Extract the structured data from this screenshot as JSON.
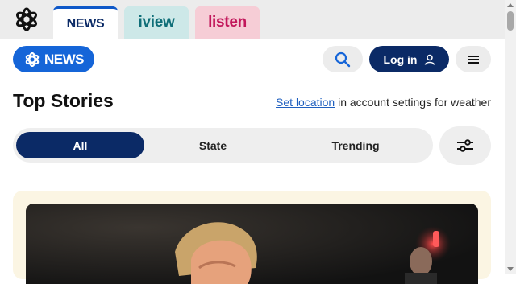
{
  "network": {
    "tabs": [
      {
        "label": "NEWS",
        "active": true,
        "color": "#0b2a66"
      },
      {
        "label": "iview",
        "active": false,
        "color": "#0f6e78"
      },
      {
        "label": "listen",
        "active": false,
        "color": "#c2175b"
      }
    ]
  },
  "header": {
    "logo_text": "NEWS",
    "login_label": "Log in",
    "brand_color": "#1565d8",
    "dark_color": "#0b2a66"
  },
  "main": {
    "title": "Top Stories",
    "location_link": "Set location",
    "location_rest": " in account settings for weather",
    "filters": [
      {
        "label": "All",
        "selected": true
      },
      {
        "label": "State",
        "selected": false
      },
      {
        "label": "Trending",
        "selected": false
      }
    ]
  },
  "icons": {
    "abc": "abc-logo-icon",
    "search": "search-icon",
    "user": "user-icon",
    "menu": "hamburger-menu-icon",
    "filter": "sliders-icon"
  }
}
